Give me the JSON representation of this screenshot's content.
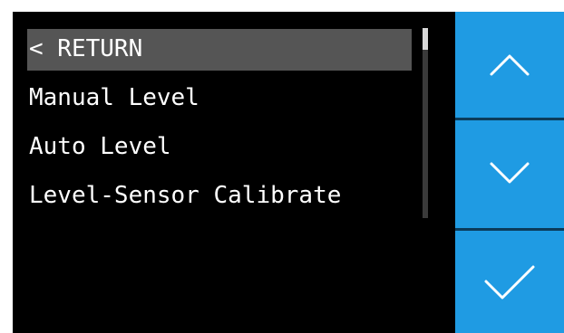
{
  "menu": {
    "items": [
      {
        "label": "< RETURN",
        "selected": true
      },
      {
        "label": "Manual Level",
        "selected": false
      },
      {
        "label": "Auto Level",
        "selected": false
      },
      {
        "label": "Level-Sensor Calibrate",
        "selected": false
      }
    ]
  },
  "scroll": {
    "position": 0
  },
  "nav": {
    "up_icon": "chevron-up-icon",
    "down_icon": "chevron-down-icon",
    "confirm_icon": "check-icon"
  },
  "colors": {
    "screen_bg": "#000000",
    "selected_bg": "#555555",
    "nav_bg": "#1f9be3",
    "text": "#ffffff",
    "divider": "#0b3b5a"
  }
}
